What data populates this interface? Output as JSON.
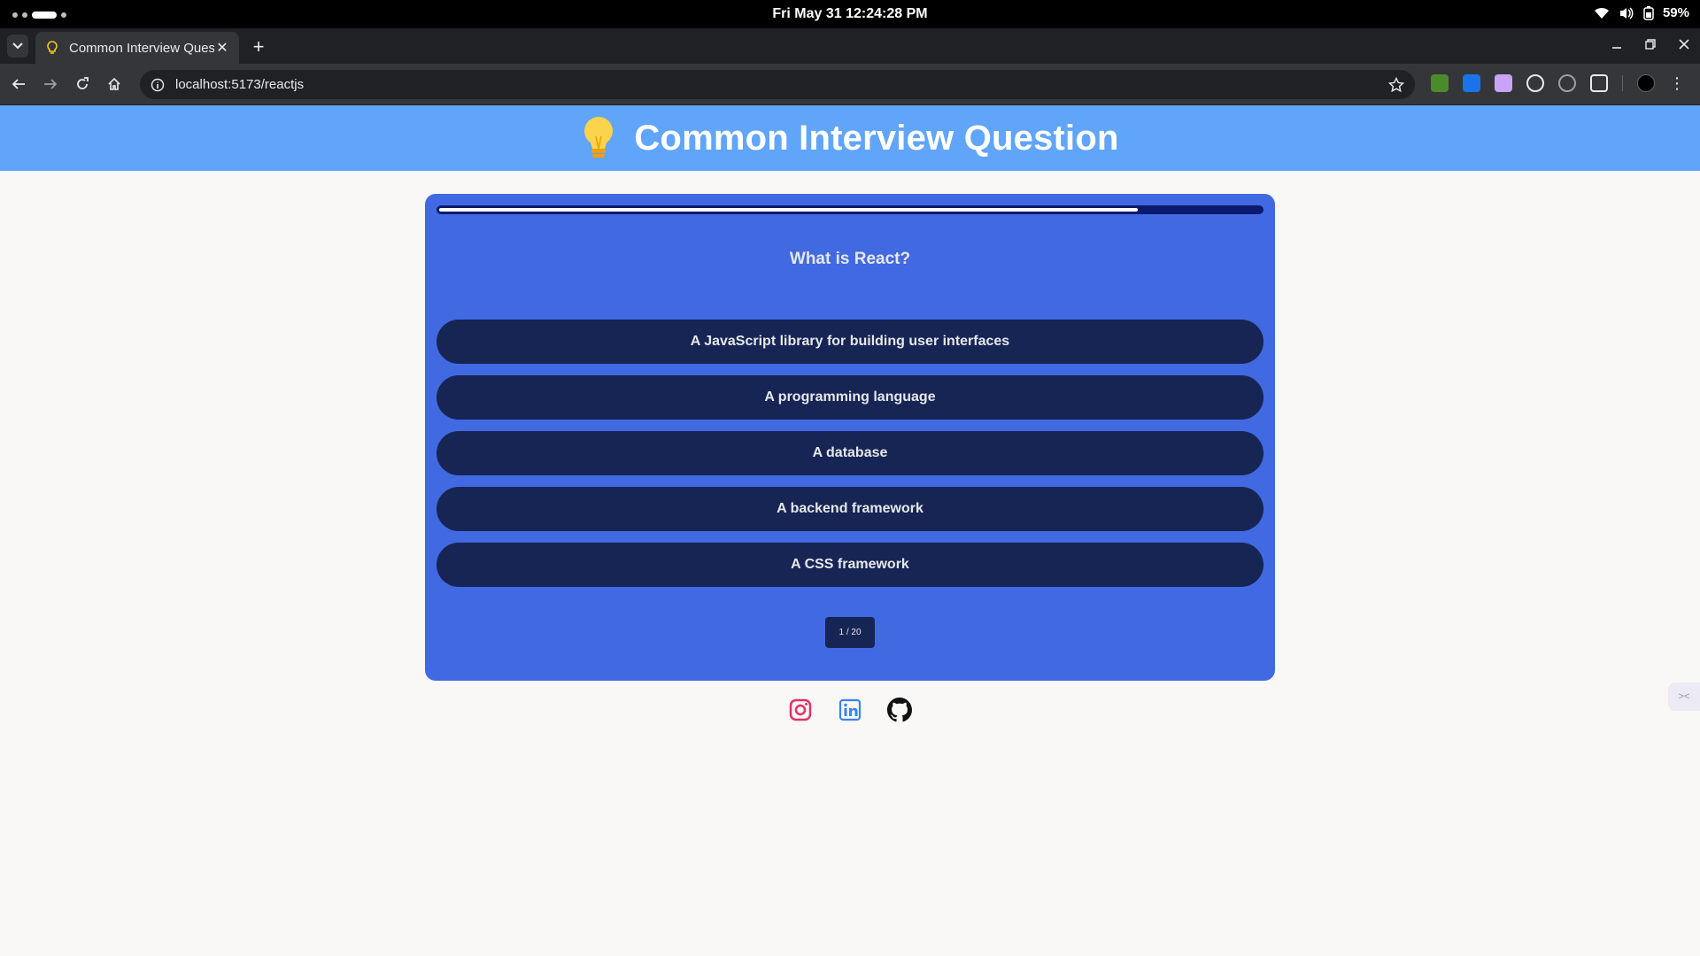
{
  "os": {
    "clock": "Fri May 31  12:24:28 PM",
    "battery": "59%"
  },
  "browser": {
    "tab_title": "Common Interview Ques",
    "url": "localhost:5173/reactjs"
  },
  "page": {
    "title": "Common Interview Question",
    "quiz": {
      "progress": 0.85,
      "question": "What is React?",
      "options": [
        "A JavaScript library for building user interfaces",
        "A programming language",
        "A database",
        "A backend framework",
        "A CSS framework"
      ],
      "counter": "1 / 20"
    },
    "socials": [
      "instagram-icon",
      "linkedin-icon",
      "github-icon"
    ]
  },
  "colors": {
    "header_bg": "#60a5fa",
    "card_bg": "#4169e1",
    "option_bg": "#172554",
    "page_bg": "#f9f8f6"
  }
}
